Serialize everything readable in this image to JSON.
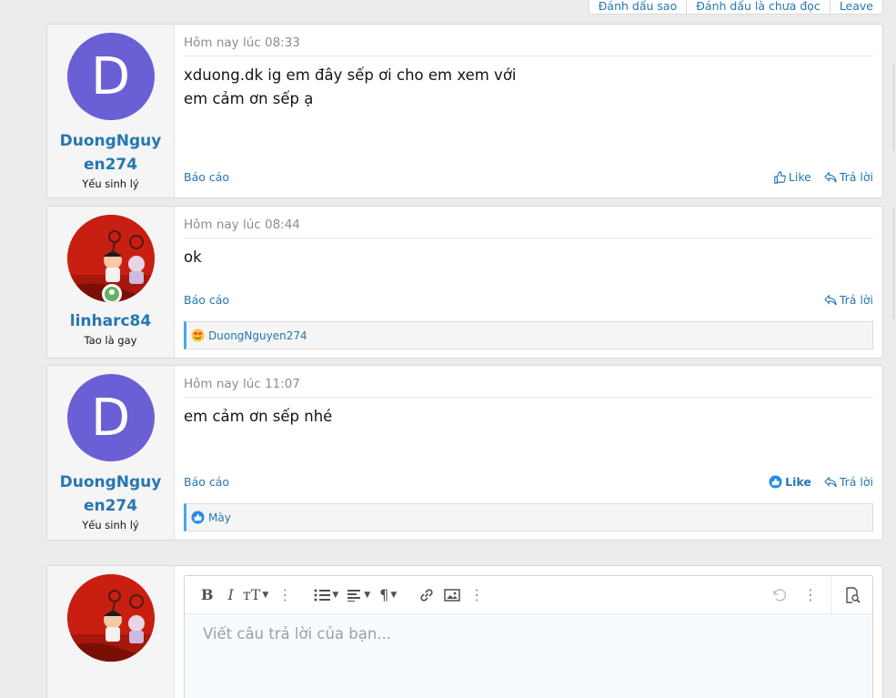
{
  "top_actions": [
    "Đánh dấu sao",
    "Đánh dấu là chưa đọc",
    "Leave"
  ],
  "posts": [
    {
      "avatar_letter": "D",
      "username": "DuongNguyen274",
      "user_title": "Yếu sinh lý",
      "time": "Hôm nay lúc 08:33",
      "message_lines": [
        "xduong.dk ig em đây sếp ơi cho em xem với",
        "em cảm ơn sếp ạ"
      ],
      "report": "Báo cáo",
      "like": "Like",
      "reply": "Trả lời"
    },
    {
      "username": "linharc84",
      "user_title": "Tao là gay",
      "time": "Hôm nay lúc 08:44",
      "message_lines": [
        "ok"
      ],
      "report": "Báo cáo",
      "reply": "Trả lời",
      "reaction_user": "DuongNguyen274"
    },
    {
      "avatar_letter": "D",
      "username": "DuongNguyen274",
      "user_title": "Yếu sinh lý",
      "time": "Hôm nay lúc 11:07",
      "message_lines": [
        "em cảm ơn sếp nhé"
      ],
      "report": "Báo cáo",
      "like": "Like",
      "reply": "Trả lời",
      "reaction_user": "Mày"
    }
  ],
  "editor": {
    "placeholder": "Viết câu trả lời của bạn..."
  },
  "colors": {
    "link": "#2577b1",
    "avatar_letter_bg": "#6b5fd6",
    "online": "#63b265",
    "reaction_bar": "#47a7eb"
  }
}
